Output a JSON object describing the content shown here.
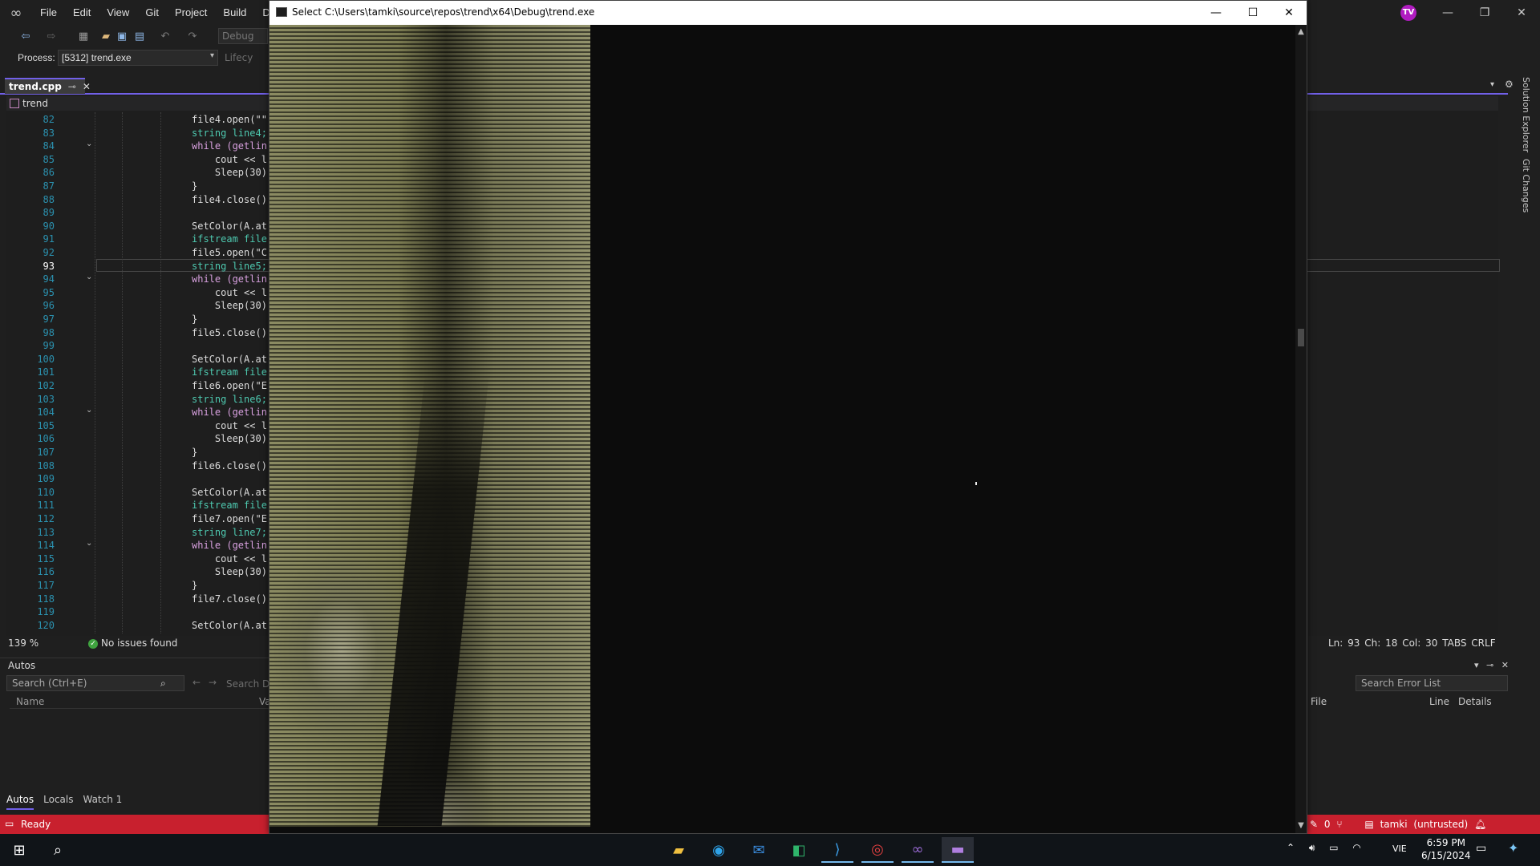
{
  "vs": {
    "menu": [
      "File",
      "Edit",
      "View",
      "Git",
      "Project",
      "Build",
      "Debu"
    ],
    "avatar_initials": "TV",
    "toolbar": {
      "config": "Debug"
    },
    "process_label": "Process:",
    "process_value": "[5312] trend.exe",
    "lifecycle_label": "Lifecy",
    "tab_label": "trend.cpp",
    "nav_scope": "trend",
    "line_numbers": [
      "82",
      "83",
      "84",
      "85",
      "86",
      "87",
      "88",
      "89",
      "90",
      "91",
      "92",
      "93",
      "94",
      "95",
      "96",
      "97",
      "98",
      "99",
      "100",
      "101",
      "102",
      "103",
      "104",
      "105",
      "106",
      "107",
      "108",
      "109",
      "110",
      "111",
      "112",
      "113",
      "114",
      "115",
      "116",
      "117",
      "118",
      "119",
      "120"
    ],
    "current_line": "93",
    "code_lines": [
      "file4.open(\"\"",
      "string line4;",
      "while (getlin",
      "    cout << l",
      "    Sleep(30)",
      "}",
      "file4.close()",
      "",
      "SetColor(A.at",
      "ifstream file",
      "file5.open(\"C",
      "string line5;",
      "while (getlin",
      "    cout << l",
      "    Sleep(30)",
      "}",
      "file5.close()",
      "",
      "SetColor(A.at",
      "ifstream file",
      "file6.open(\"E",
      "string line6;",
      "while (getlin",
      "    cout << l",
      "    Sleep(30)",
      "}",
      "file6.close()",
      "",
      "SetColor(A.at",
      "ifstream file",
      "file7.open(\"E",
      "string line7;",
      "while (getlin",
      "    cout << l",
      "    Sleep(30)",
      "}",
      "file7.close()",
      "",
      "SetColor(A.at"
    ],
    "zoom": "139 %",
    "issues": "No issues found",
    "position": {
      "ln": "Ln: 93",
      "ch": "Ch: 18",
      "col": "Col: 30",
      "tabs": "TABS",
      "eol": "CRLF"
    },
    "autos": {
      "title": "Autos",
      "search_placeholder": "Search (Ctrl+E)",
      "search_depth": "Search De",
      "col_name": "Name",
      "col_value": "Va",
      "tabs": [
        "Autos",
        "Locals",
        "Watch 1"
      ]
    },
    "error_list": {
      "search_placeholder": "Search Error List",
      "cols": [
        "File",
        "Line",
        "Details"
      ]
    },
    "status": {
      "ready": "Ready",
      "errors": "0",
      "repo": "tamki (untrusted)"
    },
    "side_rail": [
      "Solution Explorer",
      "Git Changes"
    ]
  },
  "console": {
    "title": "Select C:\\Users\\tamki\\source\\repos\\trend\\x64\\Debug\\trend.exe"
  },
  "taskbar": {
    "lang": "VIE",
    "time": "6:59 PM",
    "date": "6/15/2024",
    "apps": [
      "file-explorer",
      "edge",
      "mail",
      "meet",
      "vscode",
      "chrome",
      "visual-studio",
      "terminal"
    ]
  }
}
